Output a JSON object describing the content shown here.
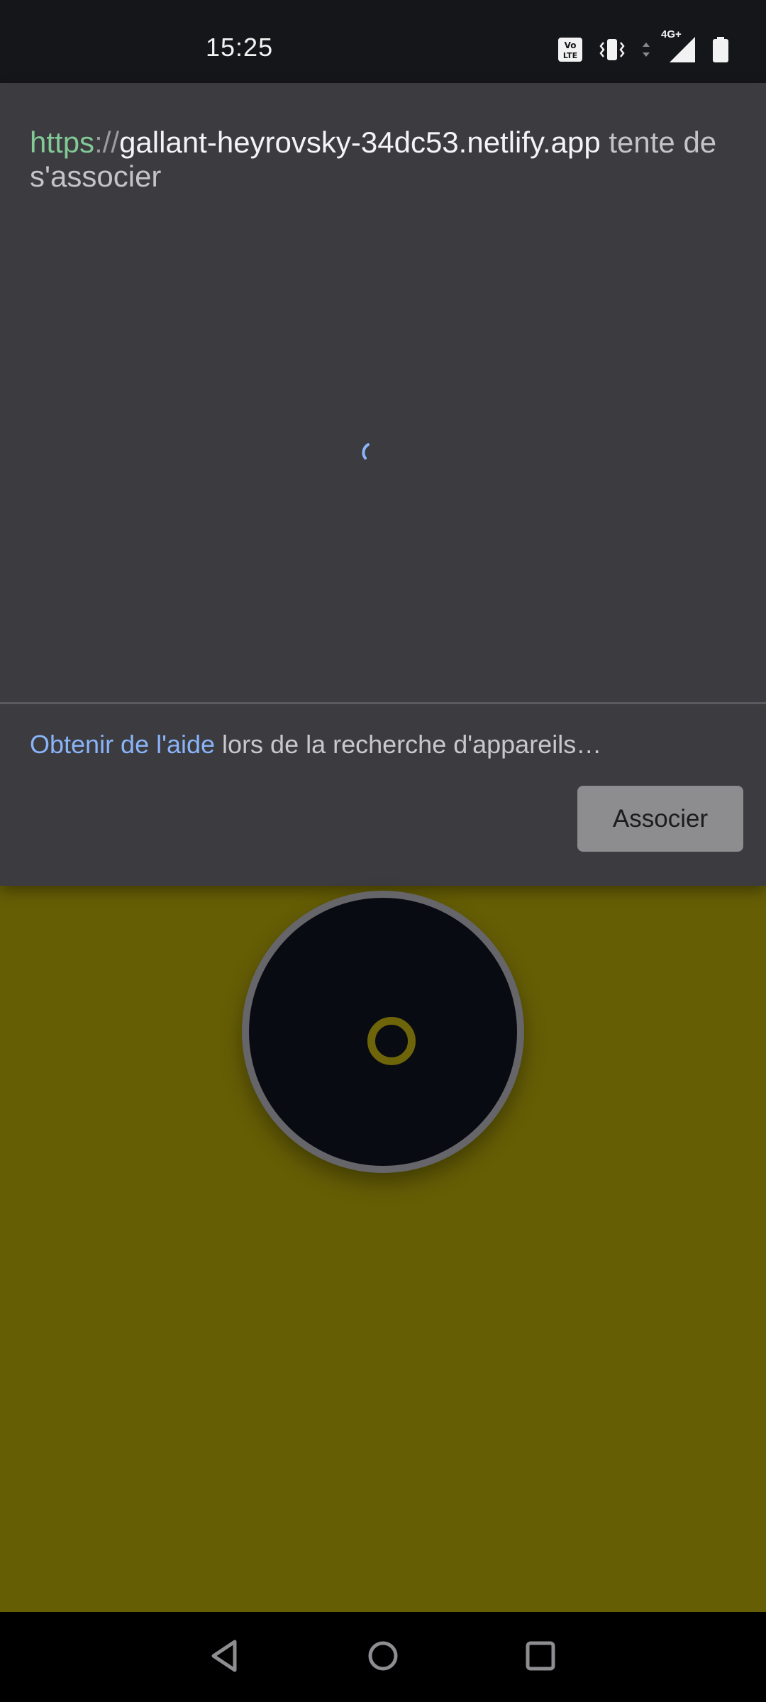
{
  "status_bar": {
    "time": "15:25",
    "network_label": "4G+",
    "icons": [
      "volte-icon",
      "vibrate-icon",
      "data-arrows-icon",
      "signal-icon",
      "battery-icon"
    ]
  },
  "dialog": {
    "origin_scheme": "https",
    "origin_separator": "://",
    "origin_host": "gallant-heyrovsky-34dc53.netlify.app",
    "title_suffix": " tente de s'associer",
    "help_link": "Obtenir de l'aide",
    "help_text": " lors de la recherche d'appareils…",
    "associate_label": "Associer",
    "spinner_icon": "loading-spinner-icon"
  },
  "background_app": {
    "background_color": "#665e05",
    "disc_icon": "ring-icon"
  },
  "nav_bar": {
    "icons": [
      "back-icon",
      "home-icon",
      "recents-icon"
    ]
  },
  "colors": {
    "dialog_bg": "#3b3b40",
    "link": "#8ab4f8",
    "secure_scheme": "#82c995",
    "button_bg": "#8d8d8f"
  }
}
